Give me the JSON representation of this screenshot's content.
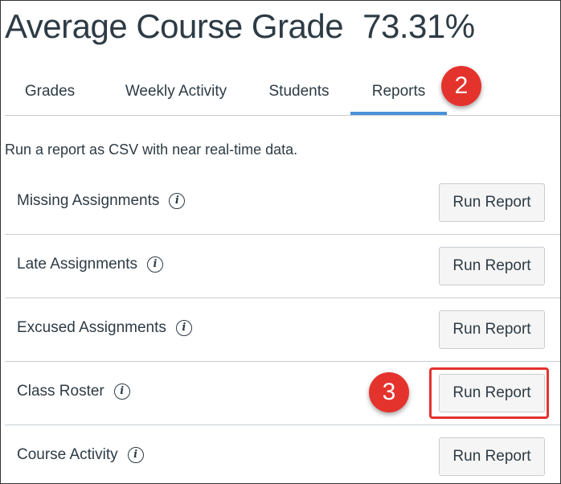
{
  "header": {
    "title": "Average Course Grade",
    "grade": "73.31%"
  },
  "tabs": [
    {
      "label": "Grades"
    },
    {
      "label": "Weekly Activity"
    },
    {
      "label": "Students"
    },
    {
      "label": "Reports",
      "active": true
    }
  ],
  "intro": "Run a report as CSV with near real-time data.",
  "reports": [
    {
      "name": "Missing Assignments",
      "button": "Run Report",
      "info_icon": "info-icon"
    },
    {
      "name": "Late Assignments",
      "button": "Run Report",
      "info_icon": "info-icon"
    },
    {
      "name": "Excused Assignments",
      "button": "Run Report",
      "info_icon": "info-icon"
    },
    {
      "name": "Class Roster",
      "button": "Run Report",
      "info_icon": "info-icon"
    },
    {
      "name": "Course Activity",
      "button": "Run Report",
      "info_icon": "info-icon"
    }
  ],
  "annotations": {
    "step2": "2",
    "step3": "3"
  },
  "colors": {
    "active_tab": "#4a90d9",
    "annotation": "#e4332d",
    "text": "#2d3b45"
  }
}
